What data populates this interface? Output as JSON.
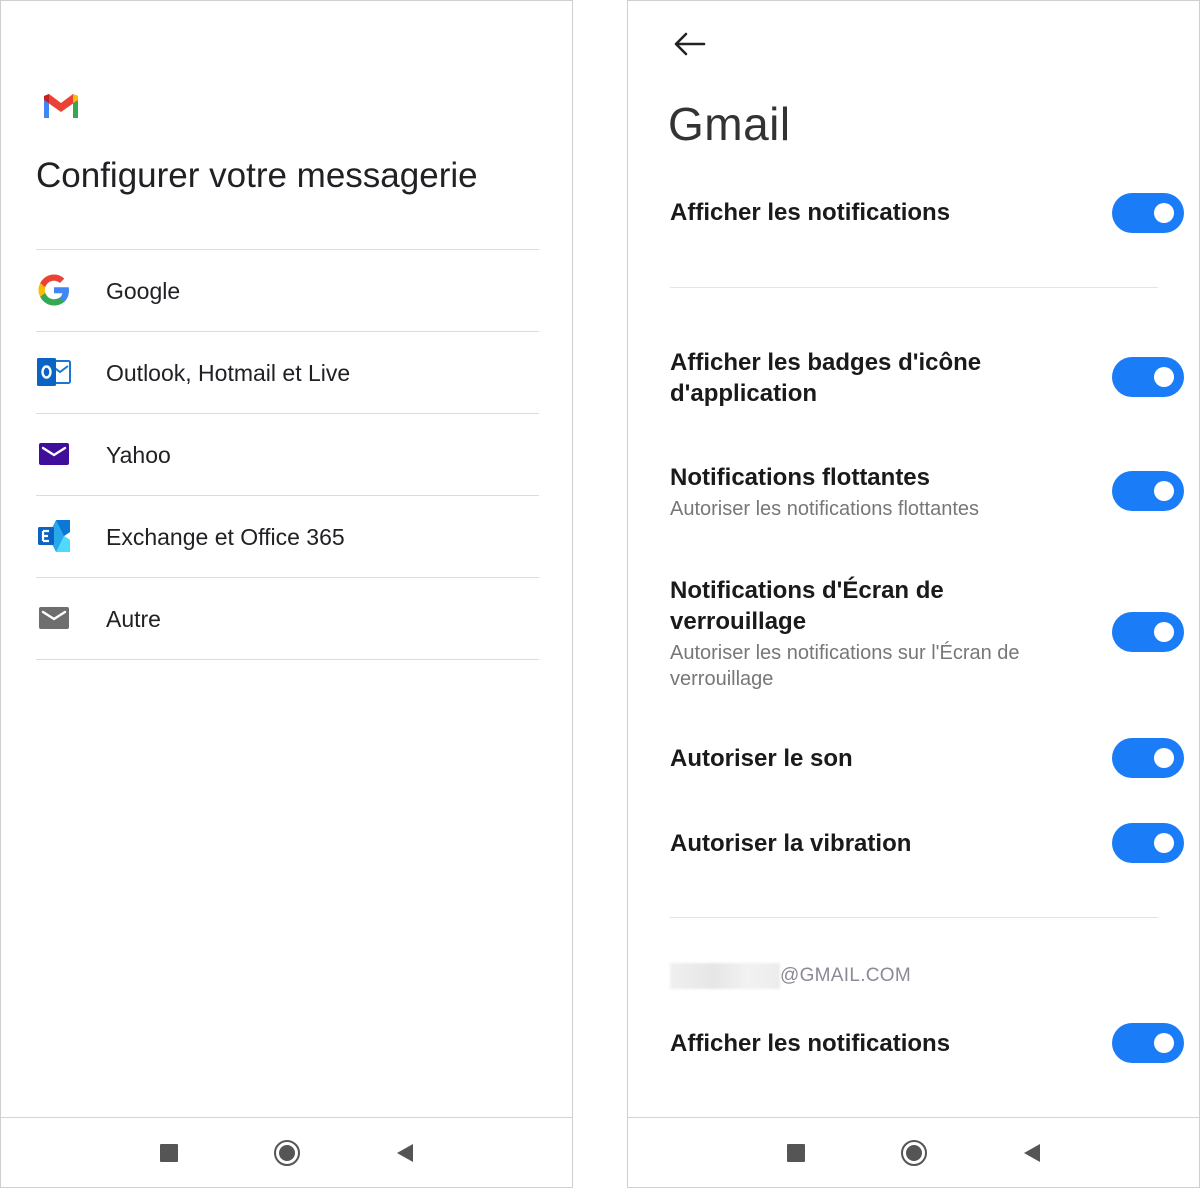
{
  "setup_screen": {
    "title": "Configurer votre messagerie",
    "logo_icon": "gmail-icon",
    "providers": [
      {
        "label": "Google",
        "icon": "google-icon"
      },
      {
        "label": "Outlook, Hotmail et Live",
        "icon": "outlook-icon"
      },
      {
        "label": "Yahoo",
        "icon": "yahoo-mail-icon"
      },
      {
        "label": "Exchange et Office 365",
        "icon": "exchange-icon"
      },
      {
        "label": "Autre",
        "icon": "mail-icon"
      }
    ]
  },
  "settings_screen": {
    "back_icon": "back-arrow-icon",
    "title": "Gmail",
    "toggle_color": "#1b7cf7",
    "settings": [
      {
        "title": "Afficher les notifications",
        "subtitle": "",
        "enabled": true
      },
      {
        "title": "Afficher les badges d'icône d'application",
        "subtitle": "",
        "enabled": true
      },
      {
        "title": "Notifications flottantes",
        "subtitle": "Autoriser les notifications flottantes",
        "enabled": true
      },
      {
        "title": "Notifications d'Écran de verrouillage",
        "subtitle": "Autoriser les notifications sur l'Écran de verrouillage",
        "enabled": true
      },
      {
        "title": "Autoriser le son",
        "subtitle": "",
        "enabled": true
      },
      {
        "title": "Autoriser la vibration",
        "subtitle": "",
        "enabled": true
      }
    ],
    "account": {
      "suffix": "@GMAIL.COM",
      "settings": [
        {
          "title": "Afficher les notifications",
          "enabled": true
        }
      ]
    }
  },
  "nav_bar": {
    "buttons": [
      "recents-icon",
      "home-icon",
      "back-icon"
    ]
  }
}
